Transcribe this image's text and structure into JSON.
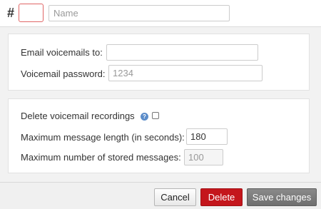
{
  "header": {
    "hash_symbol": "#",
    "number_value": "",
    "name_value": "",
    "name_placeholder": "Name"
  },
  "email_section": {
    "email_label": "Email voicemails to:",
    "email_value": "",
    "password_label": "Voicemail password:",
    "password_placeholder": "1234",
    "password_value": ""
  },
  "options_section": {
    "delete_label": "Delete voicemail recordings",
    "help_icon": "?",
    "delete_checked": false,
    "max_length_label": "Maximum message length (in seconds):",
    "max_length_value": "180",
    "max_stored_label": "Maximum number of stored messages:",
    "max_stored_placeholder": "100"
  },
  "footer": {
    "cancel_label": "Cancel",
    "delete_label": "Delete",
    "save_label": "Save changes"
  },
  "colors": {
    "delete_button": "#c4161c",
    "save_button": "#7a7a7a",
    "invalid_border": "#e06666",
    "help_icon": "#5b8cc9"
  }
}
